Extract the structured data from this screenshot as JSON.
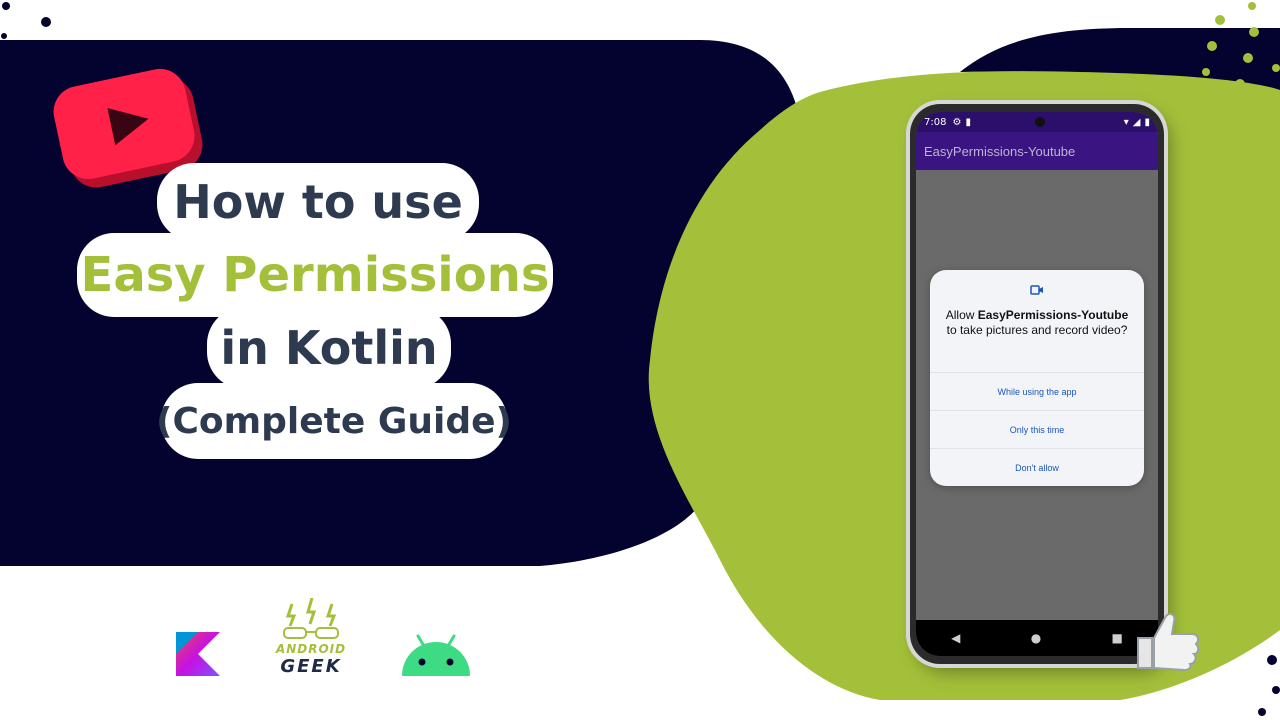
{
  "title": {
    "line1": "How to use",
    "line2": "Easy Permissions",
    "line3": "in Kotlin",
    "line4": "(Complete Guide)"
  },
  "phone": {
    "status_time": "7:08",
    "app_title": "EasyPermissions-Youtube",
    "dialog": {
      "message_prefix": "Allow ",
      "app_name": "EasyPermissions-Youtube",
      "message_suffix": " to take pictures and record video?",
      "options": [
        "While using the app",
        "Only this time",
        "Don't allow"
      ]
    },
    "nav": {
      "back": "◀",
      "home": "●",
      "recents": "■"
    }
  },
  "logos": {
    "android_geek_line1": "ANDROID",
    "android_geek_line2": "GEEK"
  },
  "colors": {
    "navy": "#04022e",
    "lime": "#a4c03a",
    "title_dark": "#2e3a4f",
    "youtube_red": "#ff2147",
    "dialog_button": "#1a56b8"
  },
  "icons": [
    "youtube-play-icon",
    "settings-icon",
    "sim-icon",
    "wifi-icon",
    "signal-icon",
    "battery-icon",
    "video-camera-icon",
    "thumbs-up-icon",
    "kotlin-logo-icon",
    "android-logo-icon"
  ]
}
